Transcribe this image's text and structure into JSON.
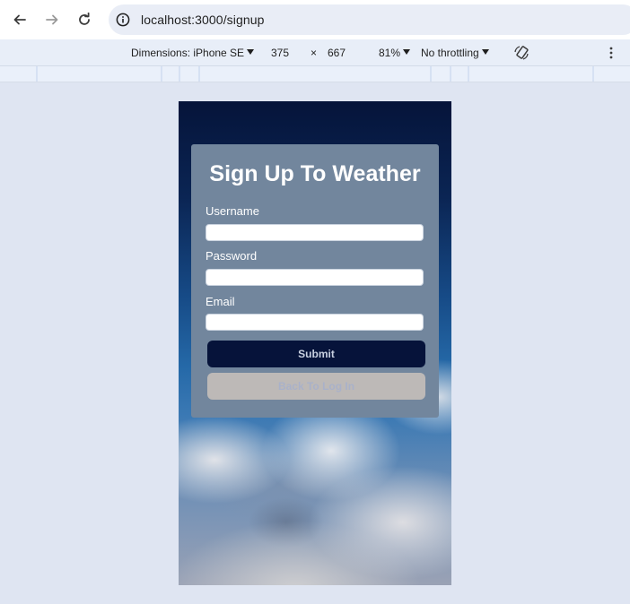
{
  "browser": {
    "url": "localhost:3000/signup",
    "icons": {
      "back": "arrow-left-icon",
      "forward": "arrow-right-icon",
      "reload": "reload-icon",
      "site_info": "info-icon"
    }
  },
  "device_toolbar": {
    "dimensions_label": "Dimensions: iPhone SE",
    "width": "375",
    "times": "×",
    "height": "667",
    "zoom": "81%",
    "throttling": "No throttling",
    "icons": {
      "rotate": "rotate-icon",
      "more": "more-vertical-icon"
    }
  },
  "form": {
    "title": "Sign Up To Weather",
    "username_label": "Username",
    "username_value": "",
    "password_label": "Password",
    "password_value": "",
    "email_label": "Email",
    "email_value": "",
    "submit_label": "Submit",
    "back_label": "Back To Log In"
  },
  "colors": {
    "card": "#72869d",
    "submit_bg": "#06133a",
    "back_bg": "#bdb9b7",
    "page_bg": "#dfe5f2"
  }
}
